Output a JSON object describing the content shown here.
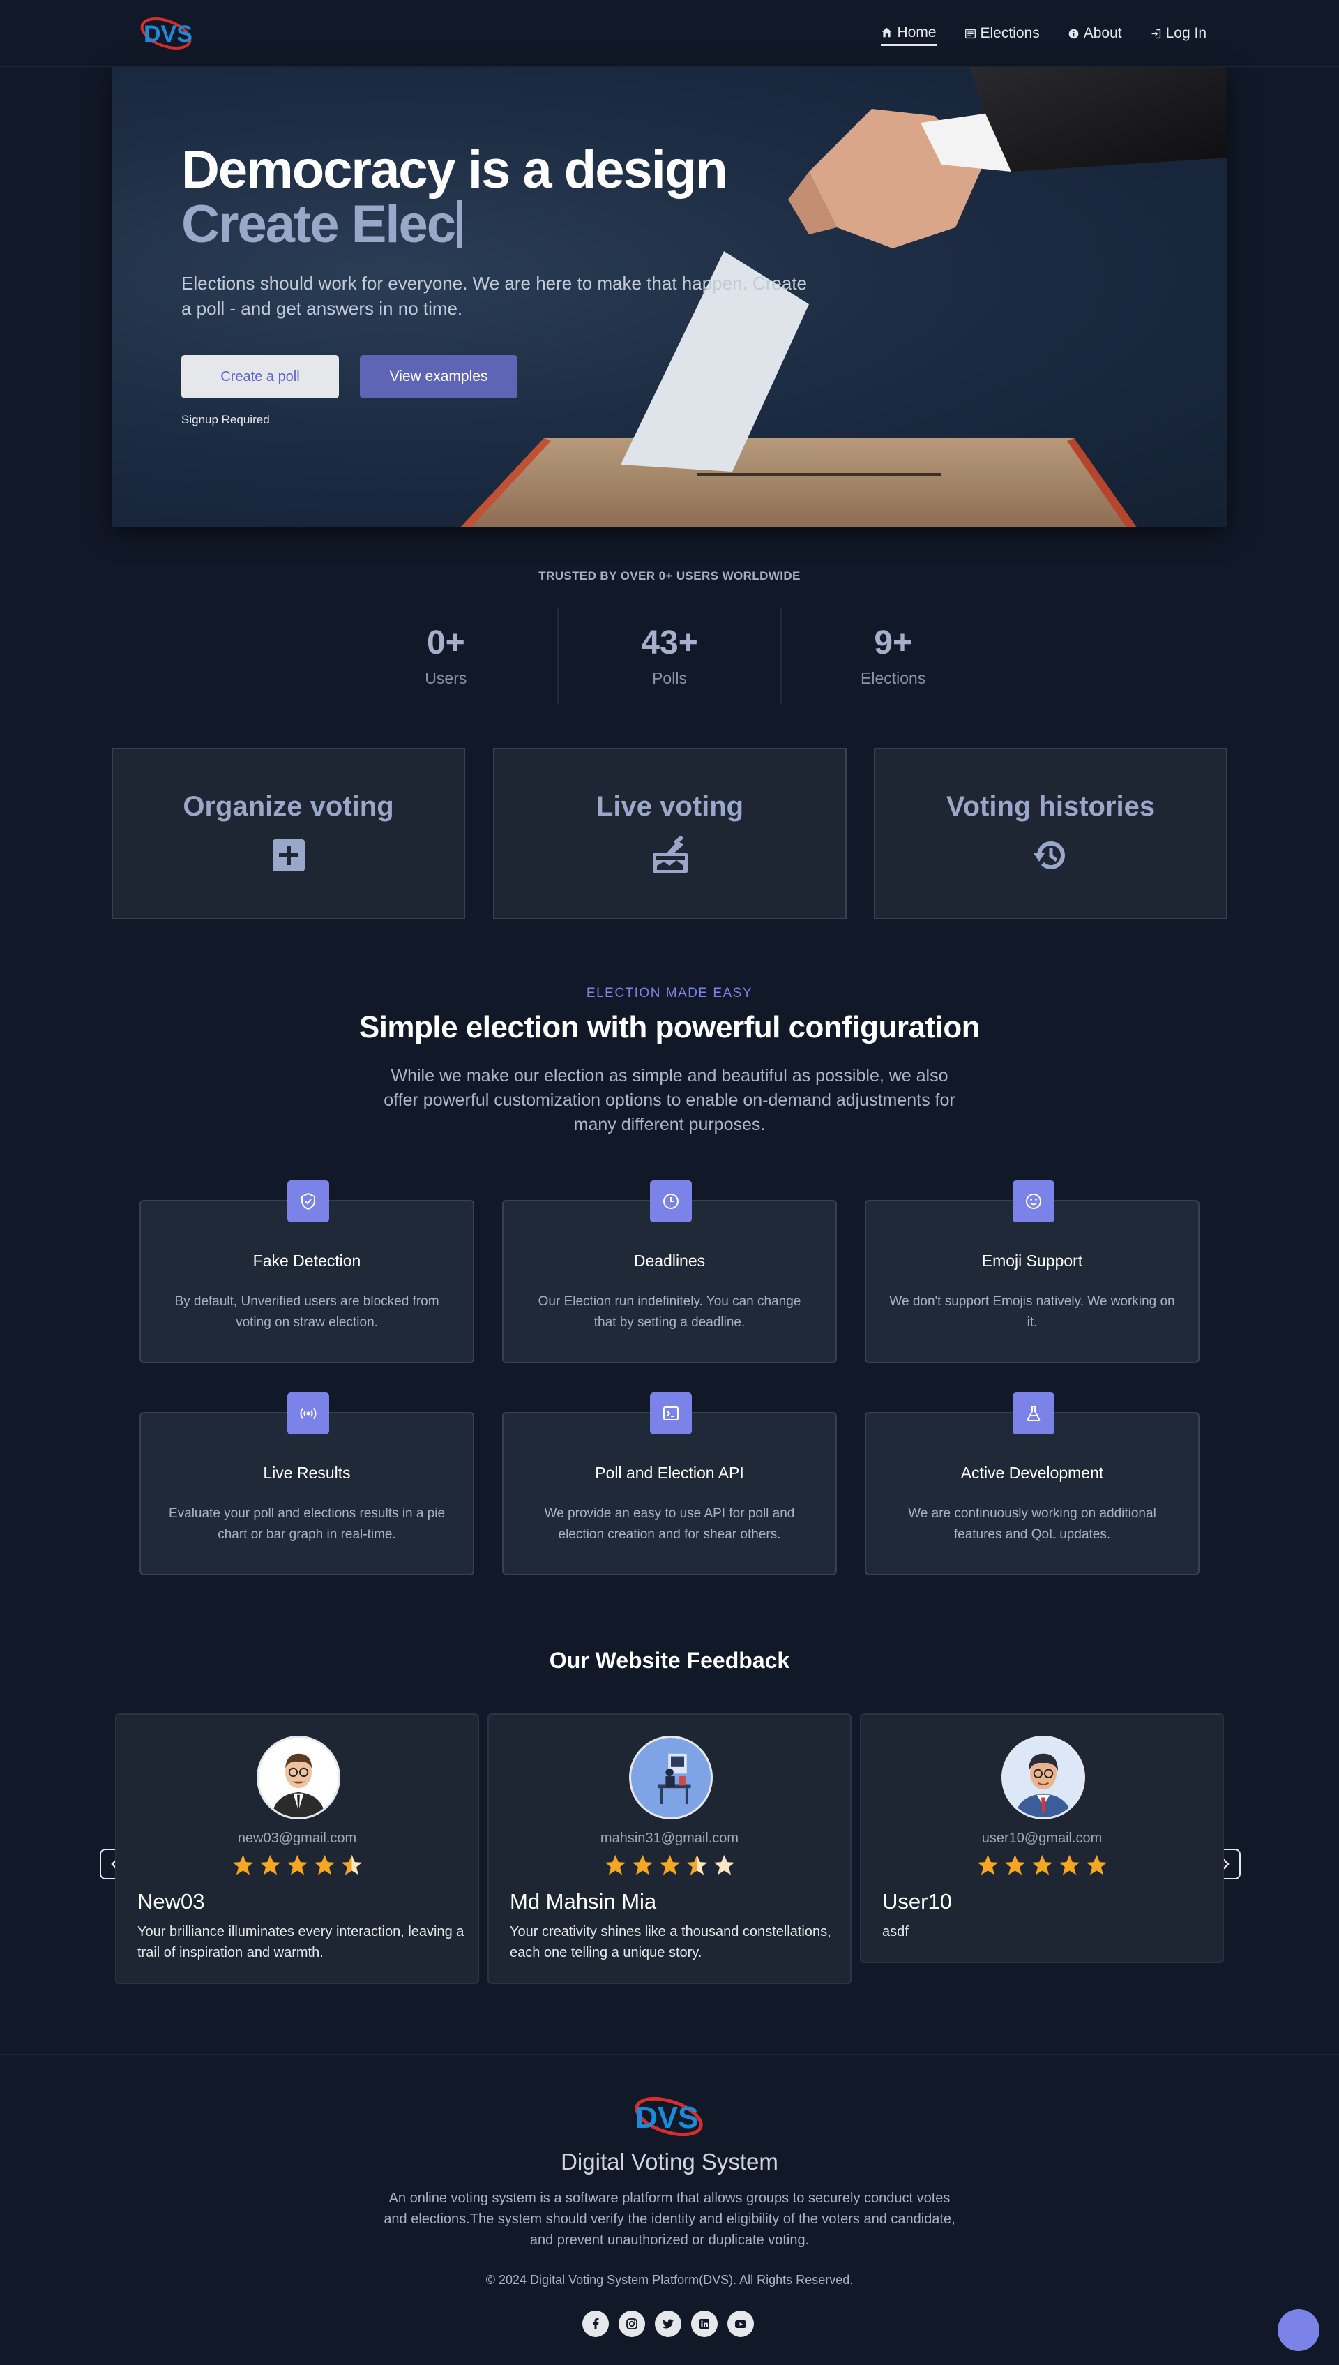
{
  "nav": {
    "logo_text": "DVS",
    "items": [
      {
        "label": "Home",
        "icon": "home-icon"
      },
      {
        "label": "Elections",
        "icon": "newspaper-icon"
      },
      {
        "label": "About",
        "icon": "info-icon"
      },
      {
        "label": "Log In",
        "icon": "login-icon"
      }
    ]
  },
  "hero": {
    "title": "Democracy is a design",
    "typing": "Create Elec",
    "description": "Elections should work for everyone. We are here to make that happen. Create a poll - and get answers in no time.",
    "create_button": "Create a poll",
    "examples_button": "View examples",
    "signup_note": "Signup Required"
  },
  "trusted": {
    "text": "TRUSTED BY OVER 0+ USERS WORLDWIDE",
    "stats": [
      {
        "value": "0+",
        "label": "Users"
      },
      {
        "value": "43+",
        "label": "Polls"
      },
      {
        "value": "9+",
        "label": "Elections"
      }
    ]
  },
  "features": [
    {
      "title": "Organize voting",
      "icon": "plus-square-icon"
    },
    {
      "title": "Live voting",
      "icon": "ballot-box-icon"
    },
    {
      "title": "Voting histories",
      "icon": "history-icon"
    }
  ],
  "config": {
    "eyebrow": "ELECTION MADE EASY",
    "title": "Simple election with powerful configuration",
    "description": "While we make our election as simple and beautiful as possible, we also offer powerful customization options to enable on-demand adjustments for many different purposes.",
    "cards": [
      {
        "title": "Fake Detection",
        "text": "By default, Unverified users are blocked from voting on straw election.",
        "icon": "shield-icon"
      },
      {
        "title": "Deadlines",
        "text": "Our Election run indefinitely. You can change that by setting a deadline.",
        "icon": "clock-icon"
      },
      {
        "title": "Emoji Support",
        "text": "We don't support Emojis natively. We working on it.",
        "icon": "smiley-icon"
      },
      {
        "title": "Live Results",
        "text": "Evaluate your poll and elections results in a pie chart or bar graph in real-time.",
        "icon": "broadcast-icon"
      },
      {
        "title": "Poll and Election API",
        "text": "We provide an easy to use API for poll and election creation and for shear others.",
        "icon": "terminal-icon"
      },
      {
        "title": "Active Development",
        "text": "We are continuously working on additional features and QoL updates.",
        "icon": "flask-icon"
      }
    ]
  },
  "feedback": {
    "title": "Our Website Feedback",
    "reviews": [
      {
        "email": "new03@gmail.com",
        "name": "New03",
        "message": "Your brilliance illuminates every interaction, leaving a trail of inspiration and warmth.",
        "rating": 4.5
      },
      {
        "email": "mahsin31@gmail.com",
        "name": "Md Mahsin Mia",
        "message": "Your creativity shines like a thousand constellations, each one telling a unique story.",
        "rating": 3.5
      },
      {
        "email": "user10@gmail.com",
        "name": "User10",
        "message": "asdf",
        "rating": 5
      }
    ]
  },
  "footer": {
    "logo_text": "DVS",
    "name": "Digital Voting System",
    "description": "An online voting system is a software platform that allows groups to securely conduct votes and elections.The system should verify the identity and eligibility of the voters and candidate, and prevent unauthorized or duplicate voting.",
    "copyright": "© 2024 Digital Voting System Platform(DVS). All Rights Reserved.",
    "social": [
      "facebook-icon",
      "instagram-icon",
      "twitter-icon",
      "linkedin-icon",
      "youtube-icon"
    ]
  },
  "colors": {
    "background": "#111827",
    "card": "#1f2937",
    "accent": "#7c83e8",
    "star": "#f5a623"
  }
}
